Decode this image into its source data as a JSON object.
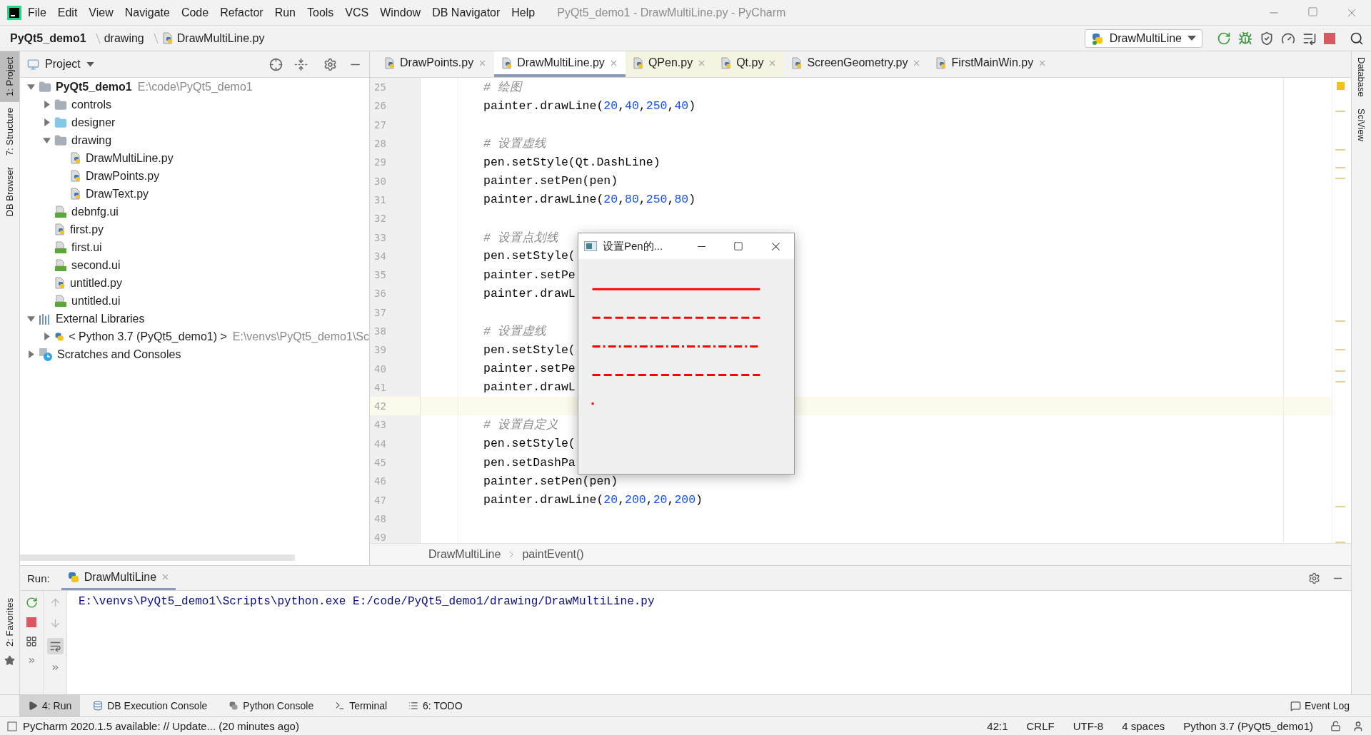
{
  "menu": {
    "items": [
      "File",
      "Edit",
      "View",
      "Navigate",
      "Code",
      "Refactor",
      "Run",
      "Tools",
      "VCS",
      "Window",
      "DB Navigator",
      "Help"
    ],
    "window_title": "PyQt5_demo1 - DrawMultiLine.py - PyCharm"
  },
  "navigation": {
    "crumbs": [
      {
        "label": "PyQt5_demo1",
        "kind": "project"
      },
      {
        "label": "drawing",
        "kind": "folder"
      },
      {
        "label": "DrawMultiLine.py",
        "kind": "file"
      }
    ],
    "run_config": "DrawMultiLine"
  },
  "left_stripe": [
    {
      "label": "1: Project",
      "selected": true,
      "kind": "top"
    },
    {
      "label": "7: Structure",
      "selected": false,
      "kind": "top"
    },
    {
      "label": "DB Browser",
      "selected": false,
      "kind": "top"
    },
    {
      "label": "2: Favorites",
      "selected": false,
      "kind": "bottom"
    }
  ],
  "right_stripe": [
    {
      "label": "Database"
    },
    {
      "label": "SciView"
    }
  ],
  "project_panel": {
    "title": "Project",
    "tree": [
      {
        "label": "PyQt5_demo1",
        "path": "E:\\code\\PyQt5_demo1",
        "kind": "project",
        "expanded": true,
        "children": [
          {
            "label": "controls",
            "kind": "folder",
            "expanded": false
          },
          {
            "label": "designer",
            "kind": "source-folder",
            "expanded": false
          },
          {
            "label": "drawing",
            "kind": "folder",
            "expanded": true,
            "children": [
              {
                "label": "DrawMultiLine.py",
                "kind": "py"
              },
              {
                "label": "DrawPoints.py",
                "kind": "py"
              },
              {
                "label": "DrawText.py",
                "kind": "py"
              }
            ]
          },
          {
            "label": "debnfg.ui",
            "kind": "ui"
          },
          {
            "label": "first.py",
            "kind": "py"
          },
          {
            "label": "first.ui",
            "kind": "ui"
          },
          {
            "label": "second.ui",
            "kind": "ui"
          },
          {
            "label": "untitled.py",
            "kind": "py"
          },
          {
            "label": "untitled.ui",
            "kind": "ui"
          }
        ]
      },
      {
        "label": "External Libraries",
        "kind": "libraries",
        "expanded": true,
        "children": [
          {
            "label": "< Python 3.7 (PyQt5_demo1) >",
            "path": "E:\\venvs\\PyQt5_demo1\\Sc",
            "kind": "python",
            "expanded": false
          }
        ]
      },
      {
        "label": "Scratches and Consoles",
        "kind": "scratches",
        "expanded": false
      }
    ]
  },
  "editor": {
    "tabs": [
      {
        "label": "DrawPoints.py",
        "selected": false,
        "highlighted": false
      },
      {
        "label": "DrawMultiLine.py",
        "selected": true,
        "highlighted": false
      },
      {
        "label": "QPen.py",
        "selected": false,
        "highlighted": true
      },
      {
        "label": "Qt.py",
        "selected": false,
        "highlighted": true
      },
      {
        "label": "ScreenGeometry.py",
        "selected": false,
        "highlighted": false
      },
      {
        "label": "FirstMainWin.py",
        "selected": false,
        "highlighted": false
      }
    ],
    "lines": [
      {
        "number": "25",
        "current": false,
        "kind": "comment",
        "segments": [
          {
            "text": "# 绘图",
            "kind": "plain"
          }
        ]
      },
      {
        "number": "26",
        "current": false,
        "kind": "code",
        "segments": [
          {
            "text": "painter.drawLine(",
            "kind": "plain"
          },
          {
            "text": "20",
            "kind": "num"
          },
          {
            "text": ",",
            "kind": "plain"
          },
          {
            "text": "40",
            "kind": "num"
          },
          {
            "text": ",",
            "kind": "plain"
          },
          {
            "text": "250",
            "kind": "num"
          },
          {
            "text": ",",
            "kind": "plain"
          },
          {
            "text": "40",
            "kind": "num"
          },
          {
            "text": ")",
            "kind": "plain"
          }
        ]
      },
      {
        "number": "27",
        "current": false,
        "kind": "blank"
      },
      {
        "number": "28",
        "current": false,
        "kind": "comment",
        "segments": [
          {
            "text": "# 设置虚线",
            "kind": "plain"
          }
        ]
      },
      {
        "number": "29",
        "current": false,
        "kind": "code",
        "segments": [
          {
            "text": "pen.setStyle(Qt.DashLine)",
            "kind": "plain"
          }
        ]
      },
      {
        "number": "30",
        "current": false,
        "kind": "code",
        "segments": [
          {
            "text": "painter.setPen(pen)",
            "kind": "plain"
          }
        ]
      },
      {
        "number": "31",
        "current": false,
        "kind": "code",
        "segments": [
          {
            "text": "painter.drawLine(",
            "kind": "plain"
          },
          {
            "text": "20",
            "kind": "num"
          },
          {
            "text": ",",
            "kind": "plain"
          },
          {
            "text": "80",
            "kind": "num"
          },
          {
            "text": ",",
            "kind": "plain"
          },
          {
            "text": "250",
            "kind": "num"
          },
          {
            "text": ",",
            "kind": "plain"
          },
          {
            "text": "80",
            "kind": "num"
          },
          {
            "text": ")",
            "kind": "plain"
          }
        ]
      },
      {
        "number": "32",
        "current": false,
        "kind": "blank"
      },
      {
        "number": "33",
        "current": false,
        "kind": "comment",
        "segments": [
          {
            "text": "# 设置点划线",
            "kind": "plain"
          }
        ]
      },
      {
        "number": "34",
        "current": false,
        "kind": "code",
        "segments": [
          {
            "text": "pen.setStyle(",
            "kind": "plain"
          }
        ]
      },
      {
        "number": "35",
        "current": false,
        "kind": "code",
        "segments": [
          {
            "text": "painter.setPe",
            "kind": "plain"
          }
        ]
      },
      {
        "number": "36",
        "current": false,
        "kind": "code",
        "segments": [
          {
            "text": "painter.drawL",
            "kind": "plain"
          }
        ]
      },
      {
        "number": "37",
        "current": false,
        "kind": "blank"
      },
      {
        "number": "38",
        "current": false,
        "kind": "comment",
        "segments": [
          {
            "text": "# 设置虚线",
            "kind": "plain"
          }
        ]
      },
      {
        "number": "39",
        "current": false,
        "kind": "code",
        "segments": [
          {
            "text": "pen.setStyle(",
            "kind": "plain"
          }
        ]
      },
      {
        "number": "40",
        "current": false,
        "kind": "code",
        "segments": [
          {
            "text": "painter.setPe",
            "kind": "plain"
          }
        ]
      },
      {
        "number": "41",
        "current": false,
        "kind": "code",
        "segments": [
          {
            "text": "painter.drawL",
            "kind": "plain"
          }
        ]
      },
      {
        "number": "42",
        "current": true,
        "kind": "blank"
      },
      {
        "number": "43",
        "current": false,
        "kind": "comment",
        "segments": [
          {
            "text": "# 设置自定义",
            "kind": "plain"
          }
        ]
      },
      {
        "number": "44",
        "current": false,
        "kind": "code",
        "segments": [
          {
            "text": "pen.setStyle(",
            "kind": "plain"
          }
        ]
      },
      {
        "number": "45",
        "current": false,
        "kind": "code",
        "segments": [
          {
            "text": "pen.setDashPa",
            "kind": "plain"
          }
        ]
      },
      {
        "number": "46",
        "current": false,
        "kind": "code",
        "segments": [
          {
            "text": "painter.setPen(pen)",
            "kind": "plain"
          }
        ]
      },
      {
        "number": "47",
        "current": false,
        "kind": "code",
        "segments": [
          {
            "text": "painter.drawLine(",
            "kind": "plain"
          },
          {
            "text": "20",
            "kind": "num"
          },
          {
            "text": ",",
            "kind": "plain"
          },
          {
            "text": "200",
            "kind": "num"
          },
          {
            "text": ",",
            "kind": "plain"
          },
          {
            "text": "20",
            "kind": "num"
          },
          {
            "text": ",",
            "kind": "plain"
          },
          {
            "text": "200",
            "kind": "num"
          },
          {
            "text": ")",
            "kind": "plain"
          }
        ]
      },
      {
        "number": "48",
        "current": false,
        "kind": "blank"
      },
      {
        "number": "49",
        "current": false,
        "kind": "blank"
      }
    ],
    "breadcrumbs": [
      "DrawMultiLine",
      "paintEvent()"
    ]
  },
  "preview_window": {
    "title": "设置Pen的...",
    "pen_samples": [
      {
        "kind": "solid"
      },
      {
        "kind": "dash"
      },
      {
        "kind": "dashdot"
      },
      {
        "kind": "dash"
      },
      {
        "kind": "dot"
      }
    ]
  },
  "run_panel": {
    "label": "Run:",
    "tabs": [
      {
        "label": "DrawMultiLine",
        "selected": true
      }
    ],
    "output": "E:\\venvs\\PyQt5_demo1\\Scripts\\python.exe E:/code/PyQt5_demo1/drawing/DrawMultiLine.py"
  },
  "tool_windows": [
    {
      "label": "4: Run",
      "selected": true,
      "kind": "run"
    },
    {
      "label": "DB Execution Console",
      "selected": false,
      "kind": "db"
    },
    {
      "label": "Python Console",
      "selected": false,
      "kind": "python"
    },
    {
      "label": "Terminal",
      "selected": false,
      "kind": "terminal"
    },
    {
      "label": "6: TODO",
      "selected": false,
      "kind": "todo"
    }
  ],
  "event_log": "Event Log",
  "status_bar": {
    "message": "PyCharm 2020.1.5 available: // Update... (20 minutes ago)",
    "items": [
      "42:1",
      "CRLF",
      "UTF-8",
      "4 spaces",
      "Python 3.7 (PyQt5_demo1)"
    ]
  }
}
